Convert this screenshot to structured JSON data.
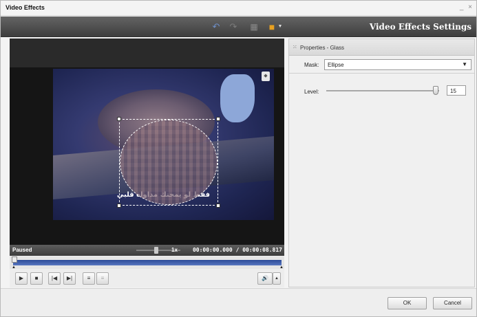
{
  "window": {
    "title": "Video Effects",
    "controls_label": "_ ×"
  },
  "toolbar": {
    "settings_title": "Video Effects Settings",
    "icons": [
      "undo-icon",
      "redo-icon",
      "grid-icon",
      "monitor-icon",
      "dropdown-arrow-icon"
    ]
  },
  "video": {
    "subtitle": "فقط لو يمحنك مداواة قلبي"
  },
  "status": {
    "state": "Paused",
    "speed": "1x",
    "time": "00:00:00.000 / 00:00:08.817"
  },
  "player_controls": {
    "icons": [
      "play-icon",
      "stop-icon",
      "previous-icon",
      "next-icon",
      "mark-in-icon",
      "mark-out-icon",
      "volume-icon",
      "volume-menu-icon"
    ]
  },
  "properties": {
    "header": "Properties - Glass",
    "mask_label": "Mask:",
    "mask_value": "Ellipse",
    "level_label": "Level:",
    "level_value": "15"
  },
  "footer": {
    "ok_label": "OK",
    "cancel_label": "Cancel"
  },
  "colors": {
    "timeline_blue": "#3d5aa8",
    "toolbar_dark": "#4a4a4a"
  }
}
